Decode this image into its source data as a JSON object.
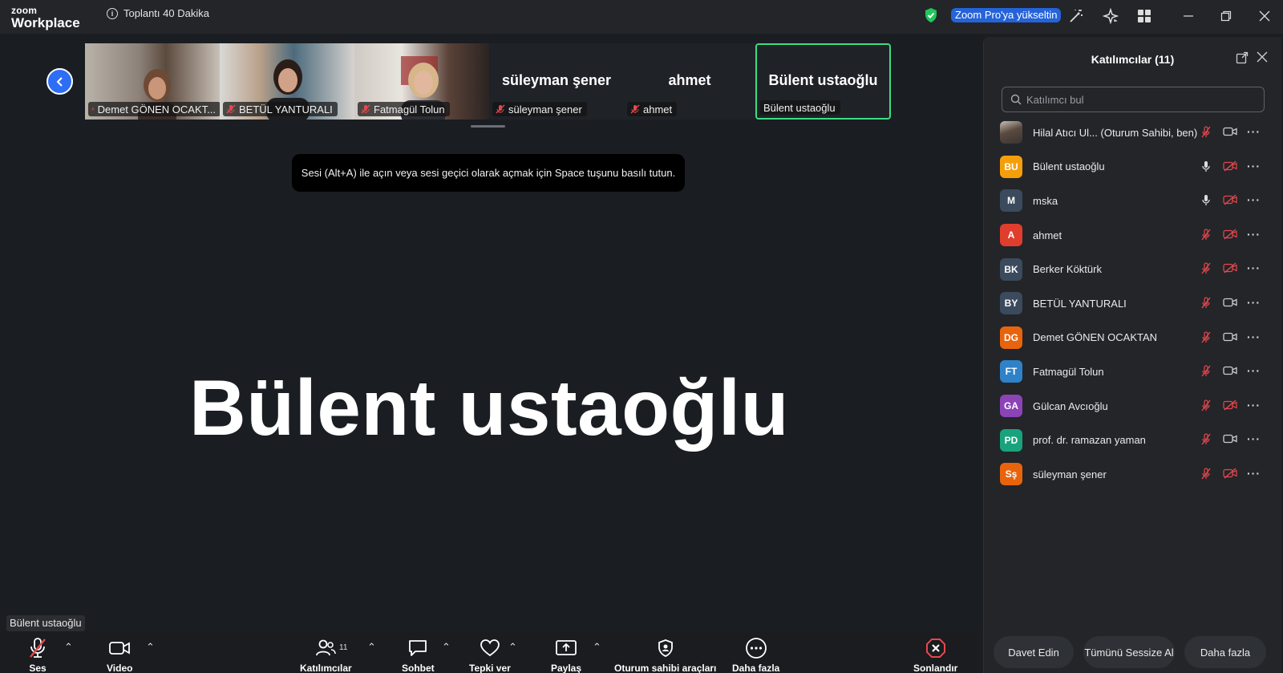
{
  "titlebar": {
    "logo_line1": "zoom",
    "logo_line2": "Workplace",
    "meeting_timer": "Toplantı 40 Dakika",
    "upgrade_label": "Zoom Pro'ya yükseltin",
    "colors": {
      "upgrade": "#2563d9",
      "shield": "#22c55e"
    }
  },
  "filmstrip": {
    "tiles": [
      {
        "name": "Demet GÖNEN OCAKT...",
        "type": "video",
        "muted": true
      },
      {
        "name": "BETÜL YANTURALI",
        "type": "video",
        "muted": true
      },
      {
        "name": "Fatmagül Tolun",
        "type": "video",
        "muted": true
      },
      {
        "name": "süleyman şener",
        "display": "süleyman şener",
        "type": "name",
        "muted": true
      },
      {
        "name": "ahmet",
        "display": "ahmet",
        "type": "name",
        "muted": true
      },
      {
        "name": "Bülent ustaoğlu",
        "display": "Bülent ustaoğlu",
        "type": "name",
        "muted": false,
        "active": true
      }
    ]
  },
  "hint": "Sesi (Alt+A) ile açın veya sesi geçici olarak açmak için Space tuşunu basılı tutun.",
  "speaker": {
    "big_name": "Bülent ustaoğlu",
    "tag": "Bülent ustaoğlu"
  },
  "toolbar": {
    "audio": "Ses",
    "video": "Video",
    "participants": "Katılımcılar",
    "participants_count": "11",
    "chat": "Sohbet",
    "react": "Tepki ver",
    "share": "Paylaş",
    "host_tools": "Oturum sahibi araçları",
    "more": "Daha fazla",
    "end": "Sonlandır"
  },
  "panel": {
    "title": "Katılımcılar (11)",
    "search_placeholder": "Katılımcı bul",
    "participants": [
      {
        "name": "Hilal Atıcı Ul...",
        "role": "(Oturum Sahibi, ben)",
        "initials": "",
        "color": "",
        "photo": true,
        "mic": "muted",
        "cam": "on"
      },
      {
        "name": "Bülent ustaoğlu",
        "role": "",
        "initials": "BU",
        "color": "#f59e0b",
        "mic": "on",
        "cam": "off"
      },
      {
        "name": "mska",
        "role": "",
        "initials": "M",
        "color": "#3b4a5c",
        "mic": "on",
        "cam": "off"
      },
      {
        "name": "ahmet",
        "role": "",
        "initials": "A",
        "color": "#e03e2d",
        "mic": "muted",
        "cam": "off"
      },
      {
        "name": "Berker Köktürk",
        "role": "",
        "initials": "BK",
        "color": "#3b4a5c",
        "mic": "muted",
        "cam": "off"
      },
      {
        "name": "BETÜL YANTURALI",
        "role": "",
        "initials": "BY",
        "color": "#3b4a5c",
        "mic": "muted",
        "cam": "on"
      },
      {
        "name": "Demet GÖNEN OCAKTAN",
        "role": "",
        "initials": "DG",
        "color": "#e8640c",
        "mic": "muted",
        "cam": "on"
      },
      {
        "name": "Fatmagül Tolun",
        "role": "",
        "initials": "FT",
        "color": "#2f82c7",
        "mic": "muted",
        "cam": "on"
      },
      {
        "name": "Gülcan Avcıoğlu",
        "role": "",
        "initials": "GA",
        "color": "#8b43b6",
        "mic": "muted",
        "cam": "off"
      },
      {
        "name": "prof. dr. ramazan yaman",
        "role": "",
        "initials": "PD",
        "color": "#19a37d",
        "mic": "muted",
        "cam": "on"
      },
      {
        "name": "süleyman şener",
        "role": "",
        "initials": "Sş",
        "color": "#e8640c",
        "mic": "muted",
        "cam": "off"
      }
    ],
    "footer": {
      "invite": "Davet Edin",
      "mute_all": "Tümünü Sessize Al",
      "more": "Daha fazla"
    }
  }
}
